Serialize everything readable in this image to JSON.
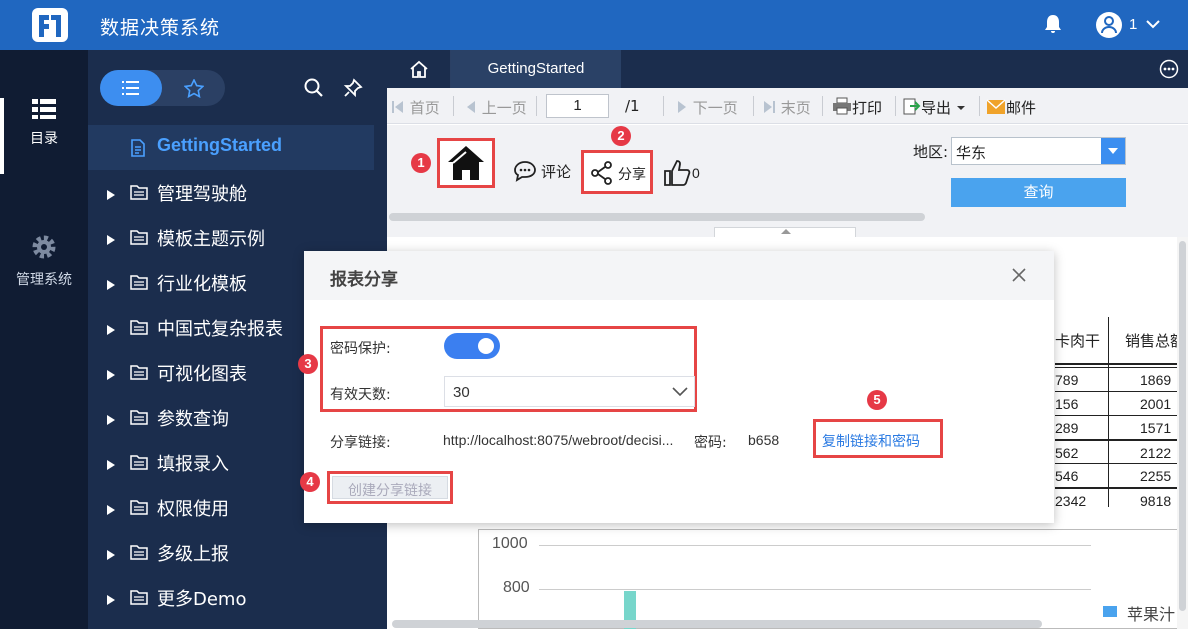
{
  "app": {
    "title": "数据决策系统",
    "user": "1"
  },
  "rail": {
    "directory_label": "目录",
    "admin_label": "管理系统"
  },
  "directory": {
    "active_item": "GettingStarted",
    "items": [
      "管理驾驶舱",
      "模板主题示例",
      "行业化模板",
      "中国式复杂报表",
      "可视化图表",
      "参数查询",
      "填报录入",
      "权限使用",
      "多级上报",
      "更多Demo"
    ]
  },
  "tabs": {
    "active": "GettingStarted"
  },
  "toolbar": {
    "first": "首页",
    "prev": "上一页",
    "page_value": "1",
    "page_total": "/1",
    "next": "下一页",
    "last": "末页",
    "print": "打印",
    "export": "导出",
    "mail": "邮件"
  },
  "params": {
    "comment": "评论",
    "share": "分享",
    "likes": "0",
    "region_label": "地区:",
    "region_value": "华东",
    "query": "查询"
  },
  "callouts": [
    "1",
    "2",
    "3",
    "4",
    "5"
  ],
  "report": {
    "col1_header": "卡肉干",
    "col2_header": "销售总额",
    "rows": [
      [
        "789",
        "1869"
      ],
      [
        "156",
        "2001"
      ],
      [
        "289",
        "1571"
      ],
      [
        "562",
        "2122"
      ],
      [
        "546",
        "2255"
      ],
      [
        "2342",
        "9818"
      ]
    ],
    "chart_ticks": [
      "1000",
      "800"
    ],
    "legend": "苹果汁"
  },
  "dialog": {
    "title": "报表分享",
    "password_label": "密码保护:",
    "password_enabled": true,
    "days_label": "有效天数:",
    "days_value": "30",
    "link_label": "分享链接:",
    "link_url": "http://localhost:8075/webroot/decisi...",
    "pw_label": "密码:",
    "pw_value": "b658",
    "copy": "复制链接和密码",
    "create": "创建分享链接"
  },
  "colors": {
    "primary": "#2067c0",
    "sidebar": "#1b2d4d",
    "rail": "#101c33",
    "accent": "#3b8ef0",
    "callout": "#e64545"
  }
}
